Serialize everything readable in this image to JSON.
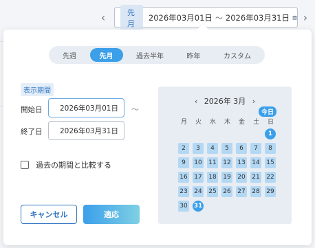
{
  "topbar": {
    "badge": "先月",
    "start": "2026年03月01日",
    "separator": "～",
    "end": "2026年03月31日",
    "prev_icon": "chevron-left-icon",
    "next_icon": "chevron-right-icon",
    "calendar_icon": "calendar-icon"
  },
  "tabs": [
    {
      "label": "先週",
      "active": false
    },
    {
      "label": "先月",
      "active": true
    },
    {
      "label": "過去半年",
      "active": false
    },
    {
      "label": "昨年",
      "active": false
    },
    {
      "label": "カスタム",
      "active": false
    }
  ],
  "form": {
    "period_label": "表示期間",
    "start_label": "開始日",
    "start_value": "2026年03月01日",
    "separator": "～",
    "end_label": "終了日",
    "end_value": "2026年03月31日",
    "compare_label": "過去の期間と比較する",
    "compare_checked": false
  },
  "buttons": {
    "cancel": "キャンセル",
    "apply": "適応"
  },
  "calendar": {
    "title": "2026年 3月",
    "prev": "‹",
    "next": "›",
    "today_label": "今日",
    "weekdays": [
      "月",
      "火",
      "水",
      "木",
      "金",
      "土",
      "日"
    ],
    "first_weekday_index": 6,
    "days_in_month": 31,
    "selected_days": [
      1,
      31
    ]
  },
  "colors": {
    "accent": "#3b9fea",
    "range_fill": "#b3d8f4",
    "link_blue": "#2f73c2"
  }
}
